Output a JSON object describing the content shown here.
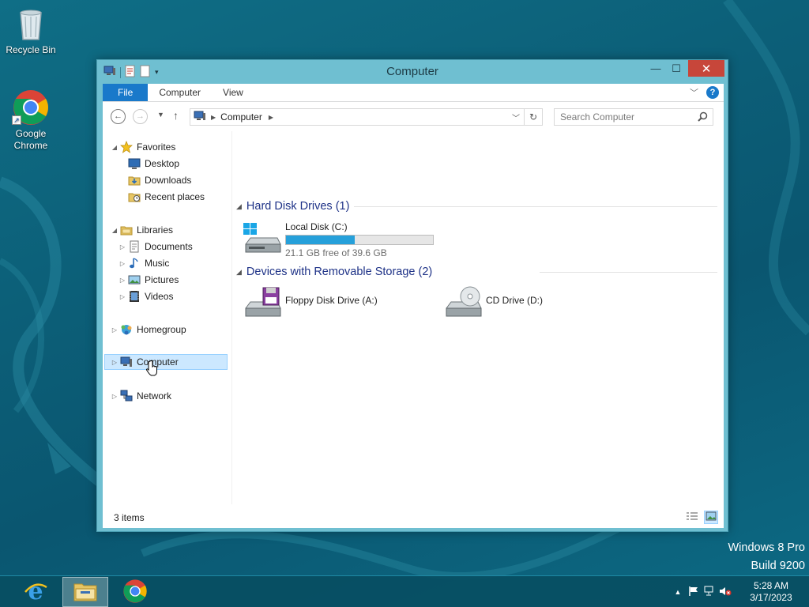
{
  "desktop": {
    "icons": [
      {
        "label": "Recycle Bin"
      },
      {
        "label": "Google Chrome"
      }
    ],
    "watermark": {
      "line1": "Windows 8 Pro",
      "line2": "Build 9200"
    }
  },
  "window": {
    "title": "Computer",
    "controls": {
      "minimize": "—",
      "maximize": "☐",
      "close": "✕"
    },
    "ribbon": {
      "tabs": [
        {
          "label": "File"
        },
        {
          "label": "Computer"
        },
        {
          "label": "View"
        }
      ],
      "help": "?"
    },
    "address": {
      "path": "Computer",
      "search_placeholder": "Search Computer"
    },
    "nav": {
      "favorites": {
        "label": "Favorites",
        "items": [
          "Desktop",
          "Downloads",
          "Recent places"
        ]
      },
      "libraries": {
        "label": "Libraries",
        "items": [
          "Documents",
          "Music",
          "Pictures",
          "Videos"
        ]
      },
      "homegroup": "Homegroup",
      "computer": "Computer",
      "network": "Network"
    },
    "groups": {
      "hard_disks": {
        "header": "Hard Disk Drives (1)",
        "drives": [
          {
            "name": "Local Disk (C:)",
            "space": "21.1 GB free of 39.6 GB",
            "used_fraction": 0.467
          }
        ]
      },
      "removable": {
        "header": "Devices with Removable Storage (2)",
        "drives": [
          {
            "name": "Floppy Disk Drive (A:)"
          },
          {
            "name": "CD Drive (D:)"
          }
        ]
      }
    },
    "status": {
      "items": "3 items"
    }
  },
  "taskbar": {
    "clock": {
      "time": "5:28 AM",
      "date": "3/17/2023"
    }
  },
  "colors": {
    "accent": "#1979ca",
    "progress": "#26a0da",
    "close": "#c7463a",
    "selection": "#cce8ff"
  }
}
